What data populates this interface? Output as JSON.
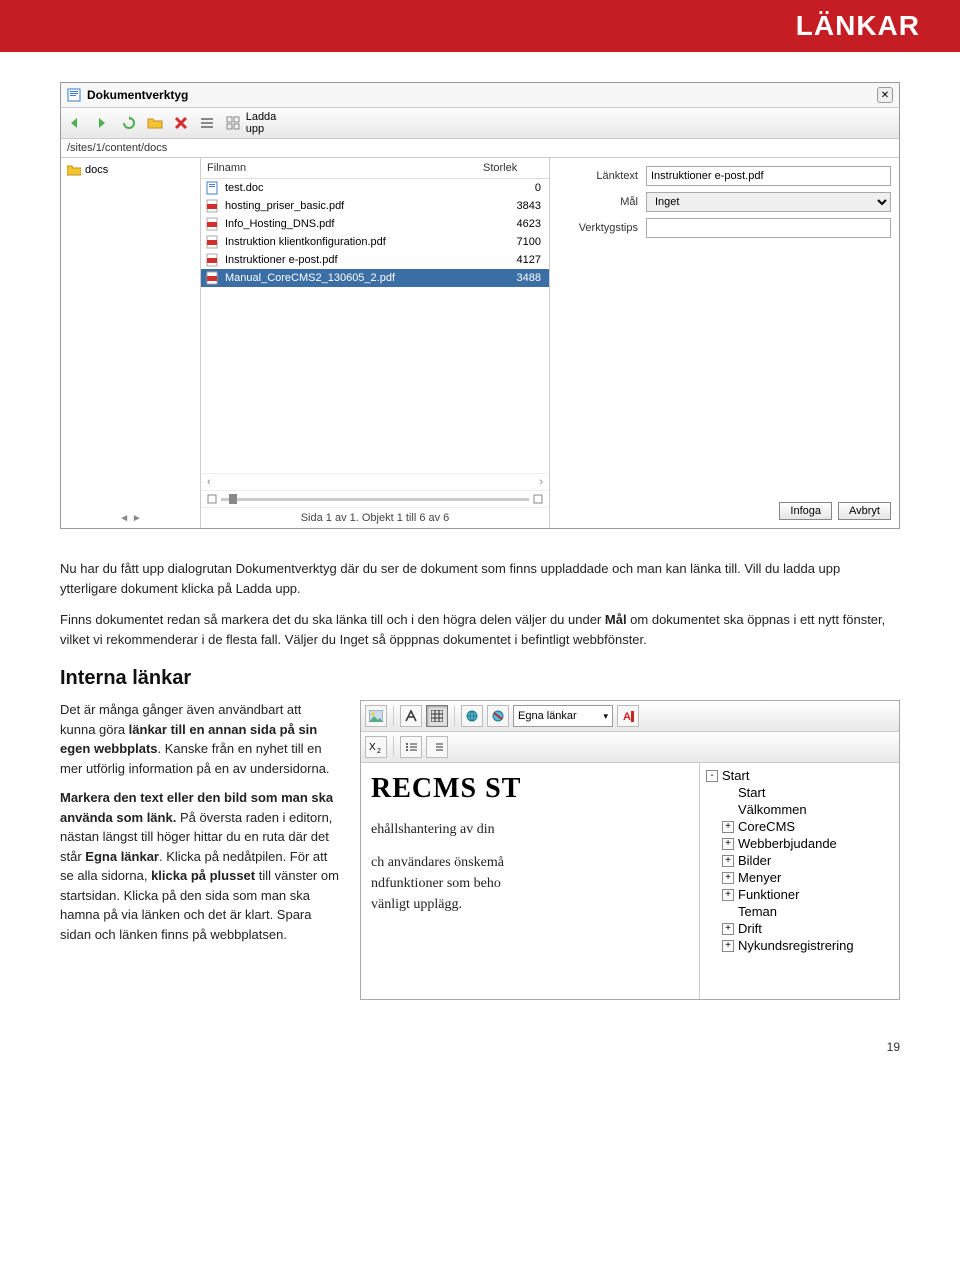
{
  "header": {
    "title": "LÄNKAR"
  },
  "dialog": {
    "title": "Dokumentverktyg",
    "upload_label": "Ladda upp",
    "path": "/sites/1/content/docs",
    "folder": "docs",
    "columns": {
      "name": "Filnamn",
      "size": "Storlek"
    },
    "files": [
      {
        "icon": "doc",
        "name": "test.doc",
        "size": "0"
      },
      {
        "icon": "pdf",
        "name": "hosting_priser_basic.pdf",
        "size": "3843"
      },
      {
        "icon": "pdf",
        "name": "Info_Hosting_DNS.pdf",
        "size": "4623"
      },
      {
        "icon": "pdf",
        "name": "Instruktion klientkonfiguration.pdf",
        "size": "7100"
      },
      {
        "icon": "pdf",
        "name": "Instruktioner e-post.pdf",
        "size": "4127"
      },
      {
        "icon": "pdf",
        "name": "Manual_CoreCMS2_130605_2.pdf",
        "size": "3488",
        "selected": true
      }
    ],
    "status": "Sida 1 av 1. Objekt 1 till 6 av 6",
    "props": {
      "linktext_label": "Länktext",
      "linktext_value": "Instruktioner e-post.pdf",
      "target_label": "Mål",
      "target_value": "Inget",
      "tooltip_label": "Verktygstips"
    },
    "buttons": {
      "insert": "Infoga",
      "cancel": "Avbryt"
    }
  },
  "body": {
    "p1": "Nu har du fått upp dialogrutan Dokumentverktyg där du ser de dokument som finns uppladdade och man kan länka till. Vill du ladda upp ytterligare dokument klicka på Ladda upp.",
    "p2a": "Finns dokumentet redan så markera det du ska länka till och i den högra delen väljer du under ",
    "p2b": "Mål",
    "p2c": " om dokumentet ska öppnas i ett nytt fönster, vilket vi rekommenderar i de flesta fall. Väljer du Inget så öpppnas dokumentet i befintligt webbfönster.",
    "h2": "Interna länkar",
    "left": {
      "p1a": "Det är många gånger även användbart att kunna göra ",
      "p1b": "länkar till en annan sida på sin egen webbplats",
      "p1c": ". Kanske från en nyhet till en mer utförlig information på en av undersidorna.",
      "p2a": "Markera den text eller den bild som man ska använda som länk.",
      "p2b": " På översta raden i editorn, nästan längst till höger hittar du en ruta där det står ",
      "p2c": "Egna länkar",
      "p2d": ". Klicka på nedåtpilen. För att se alla sidorna, ",
      "p2e": "klicka på plusset",
      "p2f": " till vänster om startsidan. Klicka på den sida som man ska hamna på via länken och det är klart. Spara sidan och länken finns på webbplatsen."
    }
  },
  "editor": {
    "dropdown_label": "Egna länkar",
    "heading": "RECMS ST",
    "p1": "ehållshantering av din",
    "p2": "ch användares önskemå",
    "p3": "ndfunktioner som beho",
    "p4": "vänligt upplägg.",
    "tree": [
      {
        "exp": "-",
        "label": "Start"
      },
      {
        "exp": "",
        "label": "Start",
        "indent": true
      },
      {
        "exp": "",
        "label": "Välkommen",
        "indent": true
      },
      {
        "exp": "+",
        "label": "CoreCMS",
        "indent": true
      },
      {
        "exp": "+",
        "label": "Webberbjudande",
        "indent": true
      },
      {
        "exp": "+",
        "label": "Bilder",
        "indent": true
      },
      {
        "exp": "+",
        "label": "Menyer",
        "indent": true
      },
      {
        "exp": "+",
        "label": "Funktioner",
        "indent": true
      },
      {
        "exp": "",
        "label": "Teman",
        "indent": true
      },
      {
        "exp": "+",
        "label": "Drift",
        "indent": true
      },
      {
        "exp": "+",
        "label": "Nykundsregistrering",
        "indent": true
      }
    ]
  },
  "page_number": "19"
}
